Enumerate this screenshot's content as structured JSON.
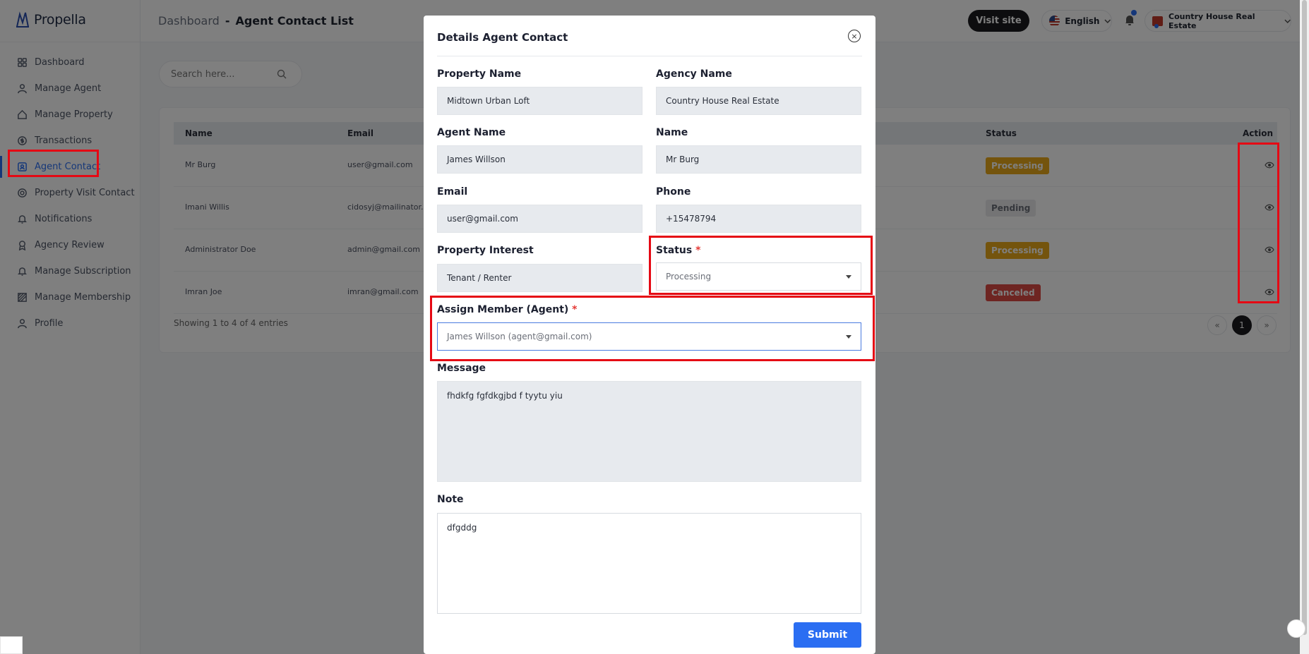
{
  "brand": {
    "name": "Propella"
  },
  "sidebar": {
    "items": [
      {
        "label": "Dashboard",
        "icon": "grid-icon"
      },
      {
        "label": "Manage Agent",
        "icon": "user-icon"
      },
      {
        "label": "Manage Property",
        "icon": "home-icon"
      },
      {
        "label": "Transactions",
        "icon": "dollar-icon"
      },
      {
        "label": "Agent Contact",
        "icon": "contact-icon",
        "active": true
      },
      {
        "label": "Property Visit Contact",
        "icon": "settings-icon"
      },
      {
        "label": "Notifications",
        "icon": "bell-icon"
      },
      {
        "label": "Agency Review",
        "icon": "review-icon"
      },
      {
        "label": "Manage Subscription",
        "icon": "bell-icon"
      },
      {
        "label": "Manage Membership",
        "icon": "membership-icon"
      },
      {
        "label": "Profile",
        "icon": "user-icon"
      }
    ]
  },
  "header": {
    "breadcrumb_root": "Dashboard",
    "breadcrumb_sep": "-",
    "breadcrumb_current": "Agent Contact List",
    "visit_site": "Visit site",
    "language": "English",
    "account_name": "Country House Real Estate"
  },
  "search": {
    "placeholder": "Search here..."
  },
  "table": {
    "columns": {
      "name": "Name",
      "email": "Email",
      "status": "Status",
      "action": "Action"
    },
    "rows": [
      {
        "name": "Mr Burg",
        "email": "user@gmail.com",
        "status": "Processing",
        "status_type": "processing"
      },
      {
        "name": "Imani Willis",
        "email": "cidosyj@mailinator.co",
        "status": "Pending",
        "status_type": "pending"
      },
      {
        "name": "Administrator Doe",
        "email": "admin@gmail.com",
        "status": "Processing",
        "status_type": "processing"
      },
      {
        "name": "Imran Joe",
        "email": "imran@gmail.com",
        "status": "Canceled",
        "status_type": "canceled"
      }
    ],
    "showing": "Showing 1 to 4 of 4 entries",
    "pager": {
      "prev": "«",
      "current": "1",
      "next": "»"
    }
  },
  "modal": {
    "title": "Details Agent Contact",
    "close": "×",
    "fields": {
      "property_name": {
        "label": "Property Name",
        "value": "Midtown Urban Loft"
      },
      "agency_name": {
        "label": "Agency Name",
        "value": "Country House Real Estate"
      },
      "agent_name": {
        "label": "Agent Name",
        "value": "James Willson"
      },
      "name": {
        "label": "Name",
        "value": "Mr Burg"
      },
      "email": {
        "label": "Email",
        "value": "user@gmail.com"
      },
      "phone": {
        "label": "Phone",
        "value": "+15478794"
      },
      "property_interest": {
        "label": "Property Interest",
        "value": "Tenant / Renter"
      },
      "status": {
        "label": "Status",
        "required": "*",
        "value": "Processing"
      },
      "assign_member": {
        "label": "Assign Member (Agent)",
        "required": "*",
        "value": "James Willson (agent@gmail.com)"
      },
      "message": {
        "label": "Message",
        "value": "fhdkfg  fgfdkgjbd f tyytu yiu"
      },
      "note": {
        "label": "Note",
        "value": "dfgddg"
      }
    },
    "submit": "Submit"
  },
  "colors": {
    "accent": "#2b6ef2",
    "processing": "#e9a81b",
    "pending": "#e9e9ea",
    "canceled": "#dd4b45",
    "annotation": "#e50914"
  }
}
